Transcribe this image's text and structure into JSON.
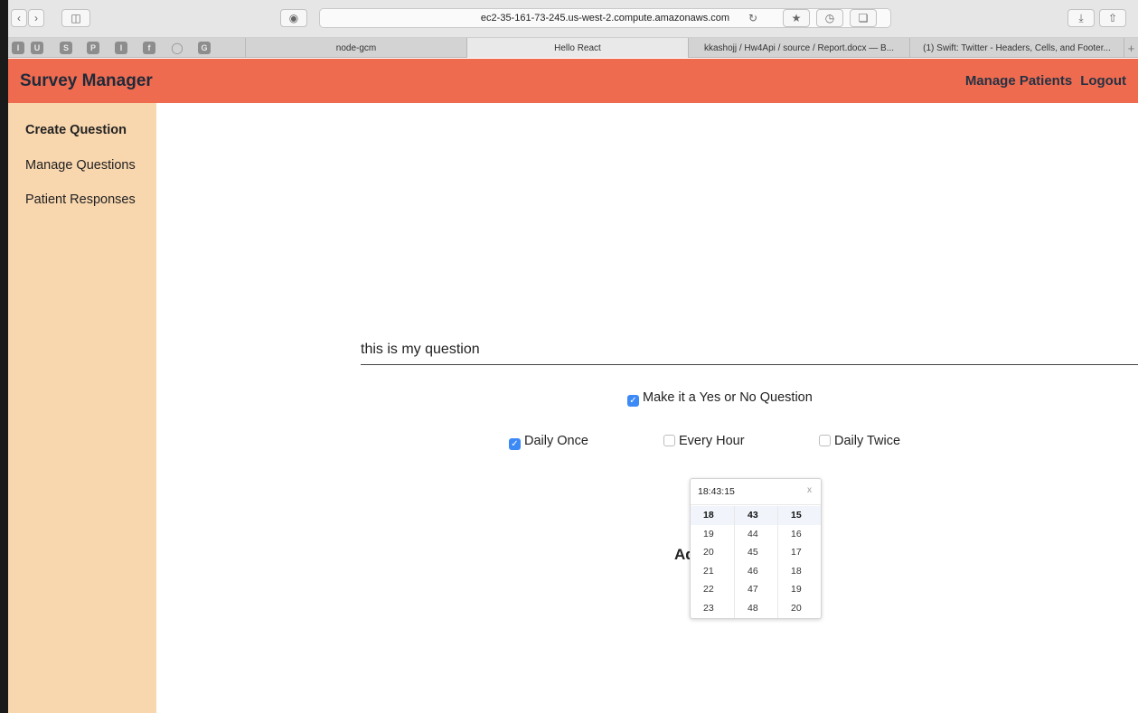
{
  "browser": {
    "url": "ec2-35-161-73-245.us-west-2.compute.amazonaws.com",
    "bookmarks": [
      "I",
      "U",
      "S",
      "P",
      "I",
      "f",
      "◯",
      "G"
    ],
    "tabs": [
      {
        "label": "node-gcm"
      },
      {
        "label": "Hello React"
      },
      {
        "label": "kkashojj / Hw4Api / source / Report.docx — B..."
      },
      {
        "label": "(1) Swift: Twitter - Headers, Cells, and Footer..."
      }
    ],
    "new_tab": "+"
  },
  "header": {
    "brand": "Survey Manager",
    "nav": [
      "Manage Patients",
      "Logout"
    ]
  },
  "sidebar": {
    "items": [
      {
        "label": "Create Question"
      },
      {
        "label": "Manage Questions"
      },
      {
        "label": "Patient Responses"
      }
    ]
  },
  "form": {
    "question": "this is my question",
    "yes_no": {
      "label": "Make it a Yes or No Question",
      "checked": true
    },
    "frequency": [
      {
        "label": "Daily Once",
        "checked": true
      },
      {
        "label": "Every Hour",
        "checked": false
      },
      {
        "label": "Daily Twice",
        "checked": false
      }
    ],
    "add_label": "Ad"
  },
  "time_picker": {
    "value": "18:43:15",
    "close": "x",
    "hours": [
      "18",
      "19",
      "20",
      "21",
      "22",
      "23"
    ],
    "minutes": [
      "43",
      "44",
      "45",
      "46",
      "47",
      "48"
    ],
    "seconds": [
      "15",
      "16",
      "17",
      "18",
      "19",
      "20"
    ]
  },
  "colors": {
    "accent": "#ef6b4f",
    "sidebar": "#f8d6ae",
    "checkbox": "#3d8af7"
  }
}
